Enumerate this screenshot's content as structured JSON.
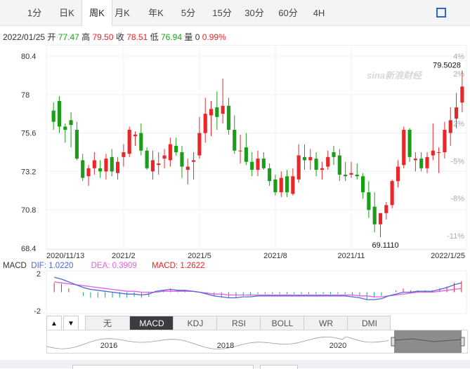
{
  "tabs": [
    {
      "label": "1分",
      "active": false
    },
    {
      "label": "日K",
      "active": false
    },
    {
      "label": "周K",
      "active": true
    },
    {
      "label": "月K",
      "active": false
    },
    {
      "label": "年K",
      "active": false
    },
    {
      "label": "5分",
      "active": false
    },
    {
      "label": "15分",
      "active": false
    },
    {
      "label": "30分",
      "active": false
    },
    {
      "label": "60分",
      "active": false
    },
    {
      "label": "4H",
      "active": false
    }
  ],
  "quote": {
    "date": "2022/01/25",
    "open_label": "开",
    "open": "77.47",
    "high_label": "高",
    "high": "79.50",
    "close_label": "收",
    "close": "78.51",
    "low_label": "低",
    "low": "76.94",
    "volume_label": "量",
    "volume": "0",
    "change": "0.99%"
  },
  "watermark": "sina新浪财经",
  "chart_data": [
    {
      "type": "candlestick",
      "period": "weekly",
      "y_ticks": [
        "80.4",
        "78",
        "75.6",
        "73.2",
        "70.8",
        "68.4"
      ],
      "pct_ticks": [
        "4%",
        "2%",
        "-2%",
        "-5%",
        "-8%",
        "-11%"
      ],
      "ylim": [
        68.4,
        80.4
      ],
      "x_ticks": [
        "2020/11/13",
        "2021/2",
        "2021/5",
        "2021/8",
        "2021/11",
        "2022/1/25"
      ],
      "annotations": {
        "max": "79.5028",
        "min": "69.1110"
      },
      "colors": {
        "up": "#e8272a",
        "down": "#1a9e1a"
      },
      "ohlc": [
        [
          77.0,
          77.5,
          75.8,
          76.3
        ],
        [
          77.6,
          77.9,
          75.6,
          76.0
        ],
        [
          76.0,
          76.2,
          75.0,
          75.8
        ],
        [
          76.4,
          76.9,
          74.7,
          76.1
        ],
        [
          75.8,
          76.3,
          73.9,
          74.0
        ],
        [
          73.9,
          74.3,
          72.6,
          72.8
        ],
        [
          72.9,
          73.6,
          72.3,
          73.4
        ],
        [
          73.4,
          74.4,
          73.0,
          73.9
        ],
        [
          73.4,
          73.9,
          72.8,
          73.2
        ],
        [
          73.2,
          74.3,
          72.7,
          74.0
        ],
        [
          74.1,
          74.6,
          72.9,
          73.2
        ],
        [
          73.1,
          74.1,
          72.7,
          73.8
        ],
        [
          74.1,
          74.9,
          73.5,
          74.4
        ],
        [
          74.3,
          76.0,
          74.1,
          75.8
        ],
        [
          75.4,
          75.7,
          74.8,
          75.5
        ],
        [
          75.6,
          76.2,
          74.2,
          74.5
        ],
        [
          74.5,
          74.7,
          73.3,
          73.4
        ],
        [
          73.2,
          74.5,
          72.7,
          73.9
        ],
        [
          73.6,
          74.4,
          73.0,
          73.7
        ],
        [
          74.0,
          74.6,
          73.4,
          74.2
        ],
        [
          73.9,
          75.3,
          73.5,
          74.9
        ],
        [
          74.8,
          75.3,
          74.2,
          74.4
        ],
        [
          74.4,
          74.8,
          72.8,
          73.5
        ],
        [
          73.3,
          74.0,
          72.4,
          73.5
        ],
        [
          73.8,
          74.4,
          72.7,
          73.9
        ],
        [
          74.2,
          76.6,
          74.0,
          75.6
        ],
        [
          75.6,
          77.8,
          75.0,
          76.8
        ],
        [
          76.7,
          77.6,
          75.4,
          77.1
        ],
        [
          77.2,
          78.2,
          75.8,
          76.6
        ],
        [
          76.8,
          79.0,
          76.2,
          77.3
        ],
        [
          77.3,
          77.8,
          75.5,
          75.8
        ],
        [
          75.8,
          76.7,
          74.3,
          74.5
        ],
        [
          74.5,
          75.5,
          73.7,
          74.5
        ],
        [
          74.7,
          75.6,
          73.6,
          73.8
        ],
        [
          73.8,
          74.4,
          72.9,
          73.3
        ],
        [
          73.3,
          74.5,
          72.9,
          74.0
        ],
        [
          74.0,
          74.4,
          73.3,
          73.4
        ],
        [
          73.4,
          73.7,
          72.3,
          72.6
        ],
        [
          72.7,
          73.0,
          71.7,
          71.9
        ],
        [
          71.9,
          73.2,
          71.6,
          72.8
        ],
        [
          72.9,
          73.3,
          71.6,
          71.9
        ],
        [
          71.8,
          73.4,
          71.7,
          72.9
        ],
        [
          72.7,
          74.9,
          72.5,
          74.2
        ],
        [
          74.1,
          74.9,
          73.3,
          73.9
        ],
        [
          73.9,
          74.6,
          73.3,
          74.1
        ],
        [
          74.0,
          74.4,
          72.9,
          73.3
        ],
        [
          73.3,
          73.8,
          72.7,
          73.4
        ],
        [
          73.5,
          74.5,
          73.3,
          74.1
        ],
        [
          74.4,
          74.8,
          73.6,
          74.1
        ],
        [
          74.2,
          74.6,
          72.6,
          73.0
        ],
        [
          73.0,
          73.8,
          72.6,
          72.9
        ],
        [
          73.0,
          73.8,
          72.8,
          73.1
        ],
        [
          73.0,
          73.7,
          72.7,
          72.9
        ],
        [
          72.9,
          73.1,
          71.5,
          71.9
        ],
        [
          71.9,
          72.6,
          70.3,
          70.8
        ],
        [
          71.0,
          71.9,
          69.4,
          69.9
        ],
        [
          69.9,
          70.6,
          69.1,
          70.6
        ],
        [
          70.6,
          71.3,
          70.2,
          71.1
        ],
        [
          71.1,
          72.7,
          70.9,
          72.6
        ],
        [
          72.6,
          73.9,
          72.2,
          73.5
        ],
        [
          73.6,
          76.0,
          73.4,
          75.8
        ],
        [
          75.8,
          75.9,
          73.8,
          74.1
        ],
        [
          73.9,
          74.4,
          73.2,
          74.0
        ],
        [
          74.0,
          74.4,
          73.2,
          73.4
        ],
        [
          73.4,
          74.4,
          73.1,
          74.1
        ],
        [
          74.2,
          76.2,
          73.9,
          74.5
        ],
        [
          74.4,
          74.7,
          73.1,
          74.4
        ],
        [
          74.4,
          76.3,
          74.0,
          75.8
        ],
        [
          75.6,
          77.2,
          74.8,
          76.4
        ],
        [
          76.5,
          78.1,
          75.9,
          77.2
        ],
        [
          77.5,
          79.5,
          76.9,
          78.5
        ]
      ]
    },
    {
      "type": "macd",
      "dif_label": "DIF:",
      "dif": "1.0220",
      "dea_label": "DEA:",
      "dea": "0.3909",
      "macd_label": "MACD:",
      "macd": "1.2622",
      "title": "MACD",
      "y_ticks": [
        "2",
        "-2"
      ],
      "colors": {
        "dif": "#4a68d8",
        "dea": "#e35ee3",
        "pos": "#e8272a",
        "neg": "#1a9e8e"
      },
      "dif_values": [
        1.6,
        1.4,
        1.1,
        0.8,
        0.5,
        0.3,
        0.2,
        0.1,
        0.0,
        -0.1,
        -0.2,
        -0.2,
        -0.3,
        -0.2,
        0.1,
        0.2,
        0.3,
        0.2,
        0.2,
        0.1,
        0.0,
        -0.2,
        -0.4,
        -0.5,
        -0.6,
        -0.6,
        -0.5,
        -0.5,
        -0.4,
        -0.4,
        -0.4,
        -0.4,
        -0.4,
        -0.4,
        -0.4,
        -0.4,
        -0.4,
        -0.4,
        -0.4,
        -0.4,
        -0.4,
        -0.5,
        -0.6,
        -0.8,
        -0.8,
        -0.7,
        -0.4,
        -0.2,
        0.0,
        0.0,
        0.1,
        0.1,
        0.1,
        0.3,
        0.5,
        0.8,
        1.0
      ],
      "dea_values": [
        1.1,
        1.0,
        0.9,
        0.8,
        0.7,
        0.6,
        0.5,
        0.4,
        0.3,
        0.2,
        0.1,
        0.1,
        0.0,
        0.0,
        0.0,
        0.1,
        0.1,
        0.1,
        0.1,
        0.1,
        0.0,
        -0.1,
        -0.2,
        -0.2,
        -0.3,
        -0.3,
        -0.3,
        -0.3,
        -0.3,
        -0.3,
        -0.3,
        -0.3,
        -0.3,
        -0.3,
        -0.3,
        -0.3,
        -0.3,
        -0.3,
        -0.3,
        -0.3,
        -0.3,
        -0.3,
        -0.4,
        -0.4,
        -0.5,
        -0.5,
        -0.4,
        -0.3,
        -0.2,
        -0.1,
        0.0,
        0.0,
        0.0,
        0.1,
        0.2,
        0.3,
        0.4
      ],
      "macd_values": [
        1.0,
        0.9,
        0.4,
        0.0,
        -0.4,
        -0.6,
        -0.6,
        -0.6,
        -0.6,
        -0.6,
        -0.6,
        -0.5,
        -0.6,
        -0.5,
        0.1,
        0.2,
        0.4,
        0.2,
        0.2,
        0.0,
        0.0,
        -0.2,
        -0.4,
        -0.6,
        -0.6,
        -0.6,
        -0.4,
        -0.4,
        -0.2,
        -0.2,
        -0.2,
        -0.2,
        -0.2,
        -0.2,
        -0.2,
        -0.2,
        -0.2,
        -0.2,
        -0.2,
        -0.2,
        -0.2,
        -0.4,
        -0.4,
        -0.8,
        -0.6,
        -0.4,
        0.0,
        0.2,
        0.4,
        0.2,
        0.2,
        0.2,
        0.2,
        0.4,
        0.6,
        1.0,
        1.2
      ]
    }
  ],
  "indicators": [
    {
      "label": "无",
      "active": false
    },
    {
      "label": "MACD",
      "active": true
    },
    {
      "label": "KDJ",
      "active": false
    },
    {
      "label": "RSI",
      "active": false
    },
    {
      "label": "BOLL",
      "active": false
    },
    {
      "label": "WR",
      "active": false
    },
    {
      "label": "DMI",
      "active": false
    }
  ],
  "arrows": {
    "up": "▲",
    "down": "▼"
  },
  "navigator": {
    "years": [
      "2016",
      "2018",
      "2020"
    ]
  }
}
